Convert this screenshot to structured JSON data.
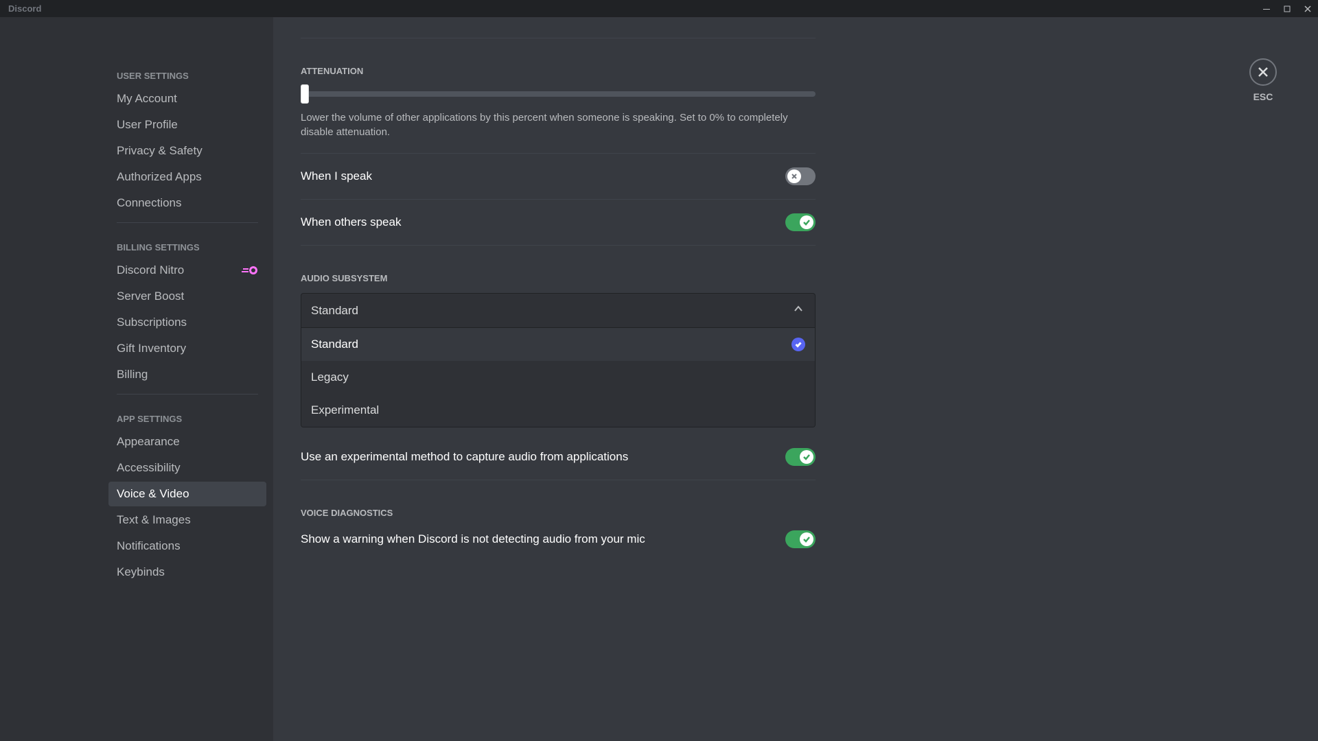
{
  "titlebar": {
    "appName": "Discord"
  },
  "closeButton": {
    "escLabel": "ESC"
  },
  "sidebar": {
    "sections": {
      "userSettings": {
        "header": "USER SETTINGS",
        "items": {
          "myAccount": "My Account",
          "userProfile": "User Profile",
          "privacySafety": "Privacy & Safety",
          "authorizedApps": "Authorized Apps",
          "connections": "Connections"
        }
      },
      "billingSettings": {
        "header": "BILLING SETTINGS",
        "items": {
          "discordNitro": "Discord Nitro",
          "serverBoost": "Server Boost",
          "subscriptions": "Subscriptions",
          "giftInventory": "Gift Inventory",
          "billing": "Billing"
        }
      },
      "appSettings": {
        "header": "APP SETTINGS",
        "items": {
          "appearance": "Appearance",
          "accessibility": "Accessibility",
          "voiceVideo": "Voice & Video",
          "textImages": "Text & Images",
          "notifications": "Notifications",
          "keybinds": "Keybinds"
        }
      }
    }
  },
  "content": {
    "attenuation": {
      "header": "ATTENUATION",
      "description": "Lower the volume of other applications by this percent when someone is speaking. Set to 0% to completely disable attenuation.",
      "sliderValue": 0
    },
    "toggles": {
      "whenISpeak": {
        "label": "When I speak",
        "enabled": false
      },
      "whenOthersSpeak": {
        "label": "When others speak",
        "enabled": true
      },
      "experimentalCapture": {
        "label": "Use an experimental method to capture audio from applications",
        "enabled": true
      },
      "voiceWarning": {
        "label": "Show a warning when Discord is not detecting audio from your mic",
        "enabled": true
      }
    },
    "audioSubsystem": {
      "header": "AUDIO SUBSYSTEM",
      "selected": "Standard",
      "options": {
        "standard": "Standard",
        "legacy": "Legacy",
        "experimental": "Experimental"
      }
    },
    "voiceDiagnostics": {
      "header": "VOICE DIAGNOSTICS"
    }
  }
}
